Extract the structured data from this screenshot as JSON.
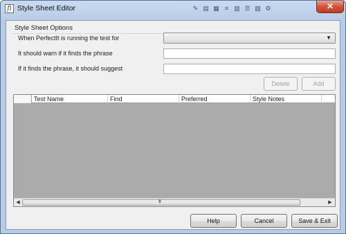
{
  "window": {
    "title": "Style Sheet Editor",
    "app_icon": "perfectit-icon",
    "close_label": "✕"
  },
  "options": {
    "group_label": "Style Sheet Options",
    "row1_label": "When PerfectIt is running the test for",
    "row1_selected": "",
    "row2_label": "It should warn if it finds the phrase",
    "row2_value": "",
    "row3_label": "If it finds the phrase, it should suggest",
    "row3_value": ""
  },
  "actions": {
    "delete_label": "Delete",
    "add_label": "Add"
  },
  "grid": {
    "columns": [
      "Test Name",
      "Find",
      "Preferred",
      "Style Notes"
    ],
    "rows": [],
    "scroll_grip": "III"
  },
  "footer": {
    "help_label": "Help",
    "cancel_label": "Cancel",
    "save_exit_label": "Save & Exit"
  },
  "colors": {
    "grid_background": "#ababab",
    "close_button": "#c13b20"
  }
}
